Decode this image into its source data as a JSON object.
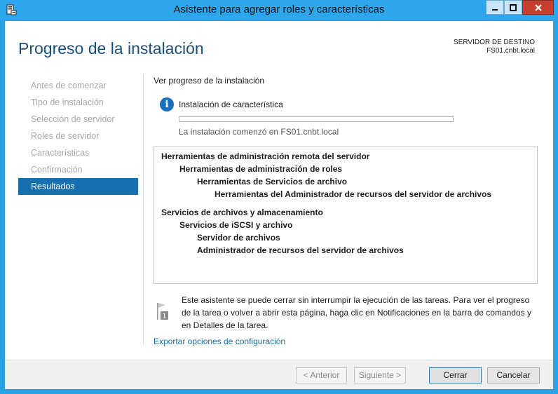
{
  "window": {
    "title": "Asistente para agregar roles y características",
    "minimize_icon": "minimize-icon",
    "maximize_icon": "maximize-icon",
    "close_icon": "close-icon"
  },
  "header": {
    "title": "Progreso de la instalación",
    "destination_label": "SERVIDOR DE DESTINO",
    "destination_server": "FS01.cnbt.local"
  },
  "nav": {
    "items": [
      {
        "label": "Antes de comenzar",
        "active": false
      },
      {
        "label": "Tipo de instalación",
        "active": false
      },
      {
        "label": "Selección de servidor",
        "active": false
      },
      {
        "label": "Roles de servidor",
        "active": false
      },
      {
        "label": "Características",
        "active": false
      },
      {
        "label": "Confirmación",
        "active": false
      },
      {
        "label": "Resultados",
        "active": true
      }
    ],
    "active_color": "#1a6fb0"
  },
  "main": {
    "section_heading": "Ver progreso de la instalación",
    "status_title": "Instalación de característica",
    "progress_fraction": 0.0,
    "status_subtitle": "La instalación comenzó en FS01.cnbt.local",
    "results": [
      {
        "label": "Herramientas de administración remota del servidor",
        "level": 0
      },
      {
        "label": "Herramientas de administración de roles",
        "level": 1
      },
      {
        "label": "Herramientas de Servicios de archivo",
        "level": 2
      },
      {
        "label": "Herramientas del Administrador de recursos del servidor de archivos",
        "level": 3
      },
      {
        "label": "Servicios de archivos y almacenamiento",
        "level": 0,
        "group_start": true
      },
      {
        "label": "Servicios de iSCSI y archivo",
        "level": 1
      },
      {
        "label": "Servidor de archivos",
        "level": 2
      },
      {
        "label": "Administrador de recursos del servidor de archivos",
        "level": 2
      }
    ],
    "notice_badge": "1",
    "notice_text": "Este asistente se puede cerrar sin interrumpir la ejecución de las tareas. Para ver el progreso de la tarea o volver a abrir esta página, haga clic en Notificaciones en la barra de comandos y en Detalles de la tarea.",
    "export_link": "Exportar opciones de configuración"
  },
  "footer": {
    "previous_label": "< Anterior",
    "next_label": "Siguiente >",
    "close_label": "Cerrar",
    "cancel_label": "Cancelar"
  },
  "colors": {
    "titlebar": "#2ea6ec",
    "heading": "#1b4f7d",
    "link": "#1a6fb0",
    "info": "#1a6fc0"
  }
}
